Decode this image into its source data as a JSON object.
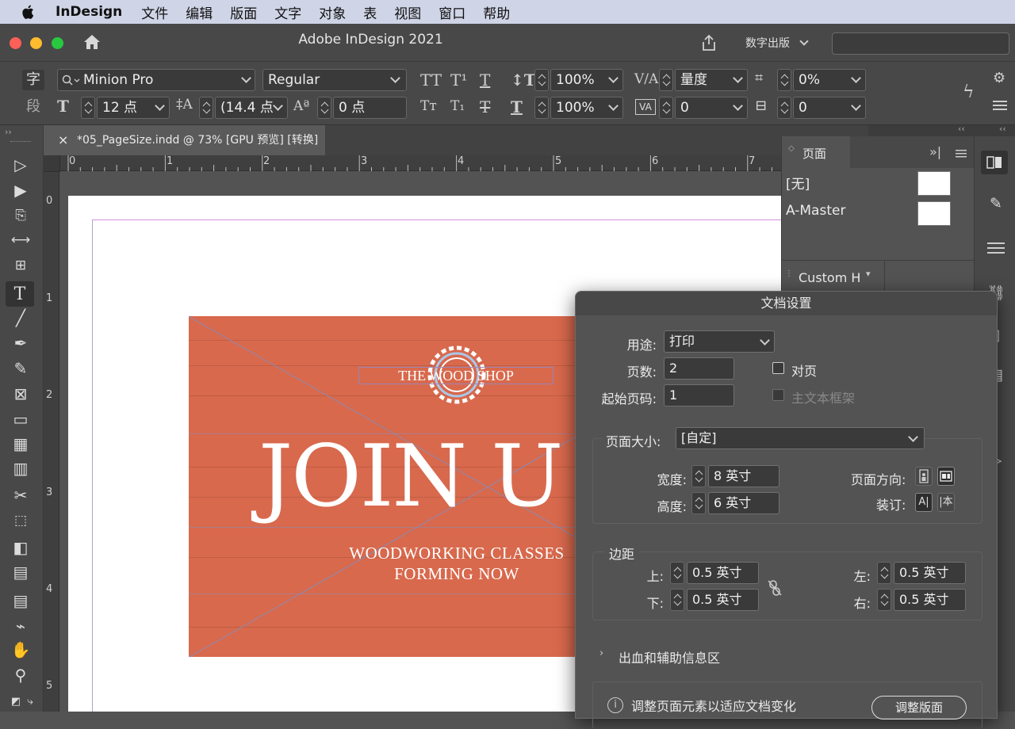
{
  "menubar": {
    "app_name": "InDesign",
    "items": [
      "文件",
      "编辑",
      "版面",
      "文字",
      "对象",
      "表",
      "视图",
      "窗口",
      "帮助"
    ]
  },
  "window": {
    "title": "Adobe InDesign 2021",
    "publish_label": "数字出版",
    "traffic_colors": {
      "close": "#fe5f57",
      "minimize": "#febc2e",
      "zoom": "#28c840"
    }
  },
  "control_panel": {
    "char_mode": "字",
    "para_mode": "段",
    "font_family": "Minion Pro",
    "font_style": "Regular",
    "font_size": "12 点",
    "leading": "(14.4 点",
    "baseline_shift": "0 点",
    "vertical_scale": "100%",
    "horizontal_scale": "100%",
    "kerning": "量度",
    "tracking": "0",
    "tsume": "0%",
    "char_spacing": "0"
  },
  "document_tab": {
    "close_glyph": "×",
    "label": "*05_PageSize.indd @ 73% [GPU 预览] [转换]"
  },
  "rulers": {
    "horizontal": [
      "0",
      "1",
      "2",
      "3",
      "4",
      "5",
      "6",
      "7"
    ],
    "vertical": [
      "0",
      "1",
      "2",
      "3",
      "4",
      "5"
    ]
  },
  "artwork": {
    "shop_name": "THE WOOD SHOP",
    "headline": "JOIN U",
    "line1": "WOODWORKING CLASSES",
    "line2": "FORMING NOW",
    "background_color": "#d8694d"
  },
  "pages_panel": {
    "title": "页面",
    "items": [
      {
        "label": "[无]"
      },
      {
        "label": "A-Master"
      }
    ],
    "size_select": "Custom H"
  },
  "document_setup": {
    "title": "文档设置",
    "intent_label": "用途:",
    "intent_value": "打印",
    "pages_label": "页数:",
    "pages_value": "2",
    "facing_label": "对页",
    "start_label": "起始页码:",
    "start_value": "1",
    "primary_frame_label": "主文本框架",
    "page_size_label": "页面大小:",
    "page_size_value": "[自定]",
    "width_label": "宽度:",
    "width_value": "8 英寸",
    "height_label": "高度:",
    "height_value": "6 英寸",
    "orientation_label": "页面方向:",
    "binding_label": "装订:",
    "margins_label": "边距",
    "top_label": "上:",
    "top_value": "0.5 英寸",
    "bottom_label": "下:",
    "bottom_value": "0.5 英寸",
    "left_label": "左:",
    "left_value": "0.5 英寸",
    "right_label": "右:",
    "right_value": "0.5 英寸",
    "bleed_label": "出血和辅助信息区",
    "adjust_label": "调整页面元素以适应文档变化",
    "adjust_button": "调整版面"
  }
}
